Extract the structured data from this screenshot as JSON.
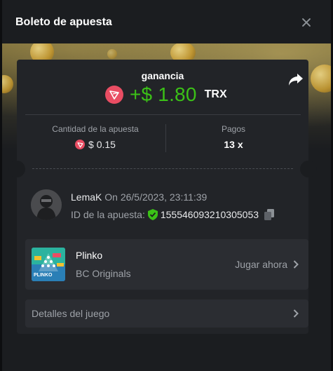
{
  "header": {
    "title": "Boleto de apuesta"
  },
  "result": {
    "label": "ganancia",
    "amount": "+$ 1.80",
    "currency": "TRX"
  },
  "stats": {
    "bet_amount_label": "Cantidad de la apuesta",
    "bet_amount_value": "$ 0.15",
    "payout_label": "Pagos",
    "payout_value": "13 x"
  },
  "user": {
    "name": "LemaK",
    "time": "On 26/5/2023, 23:11:39",
    "bet_id_label": "ID de la apuesta:",
    "bet_id": "155546093210305053"
  },
  "game": {
    "name": "Plinko",
    "provider": "BC Originals",
    "play_label": "Jugar ahora",
    "thumb_text": "PLINKO"
  },
  "details": {
    "label": "Detalles del juego"
  },
  "colors": {
    "win": "#3bc117",
    "trx": "#e94d63",
    "verified": "#3bc117"
  }
}
